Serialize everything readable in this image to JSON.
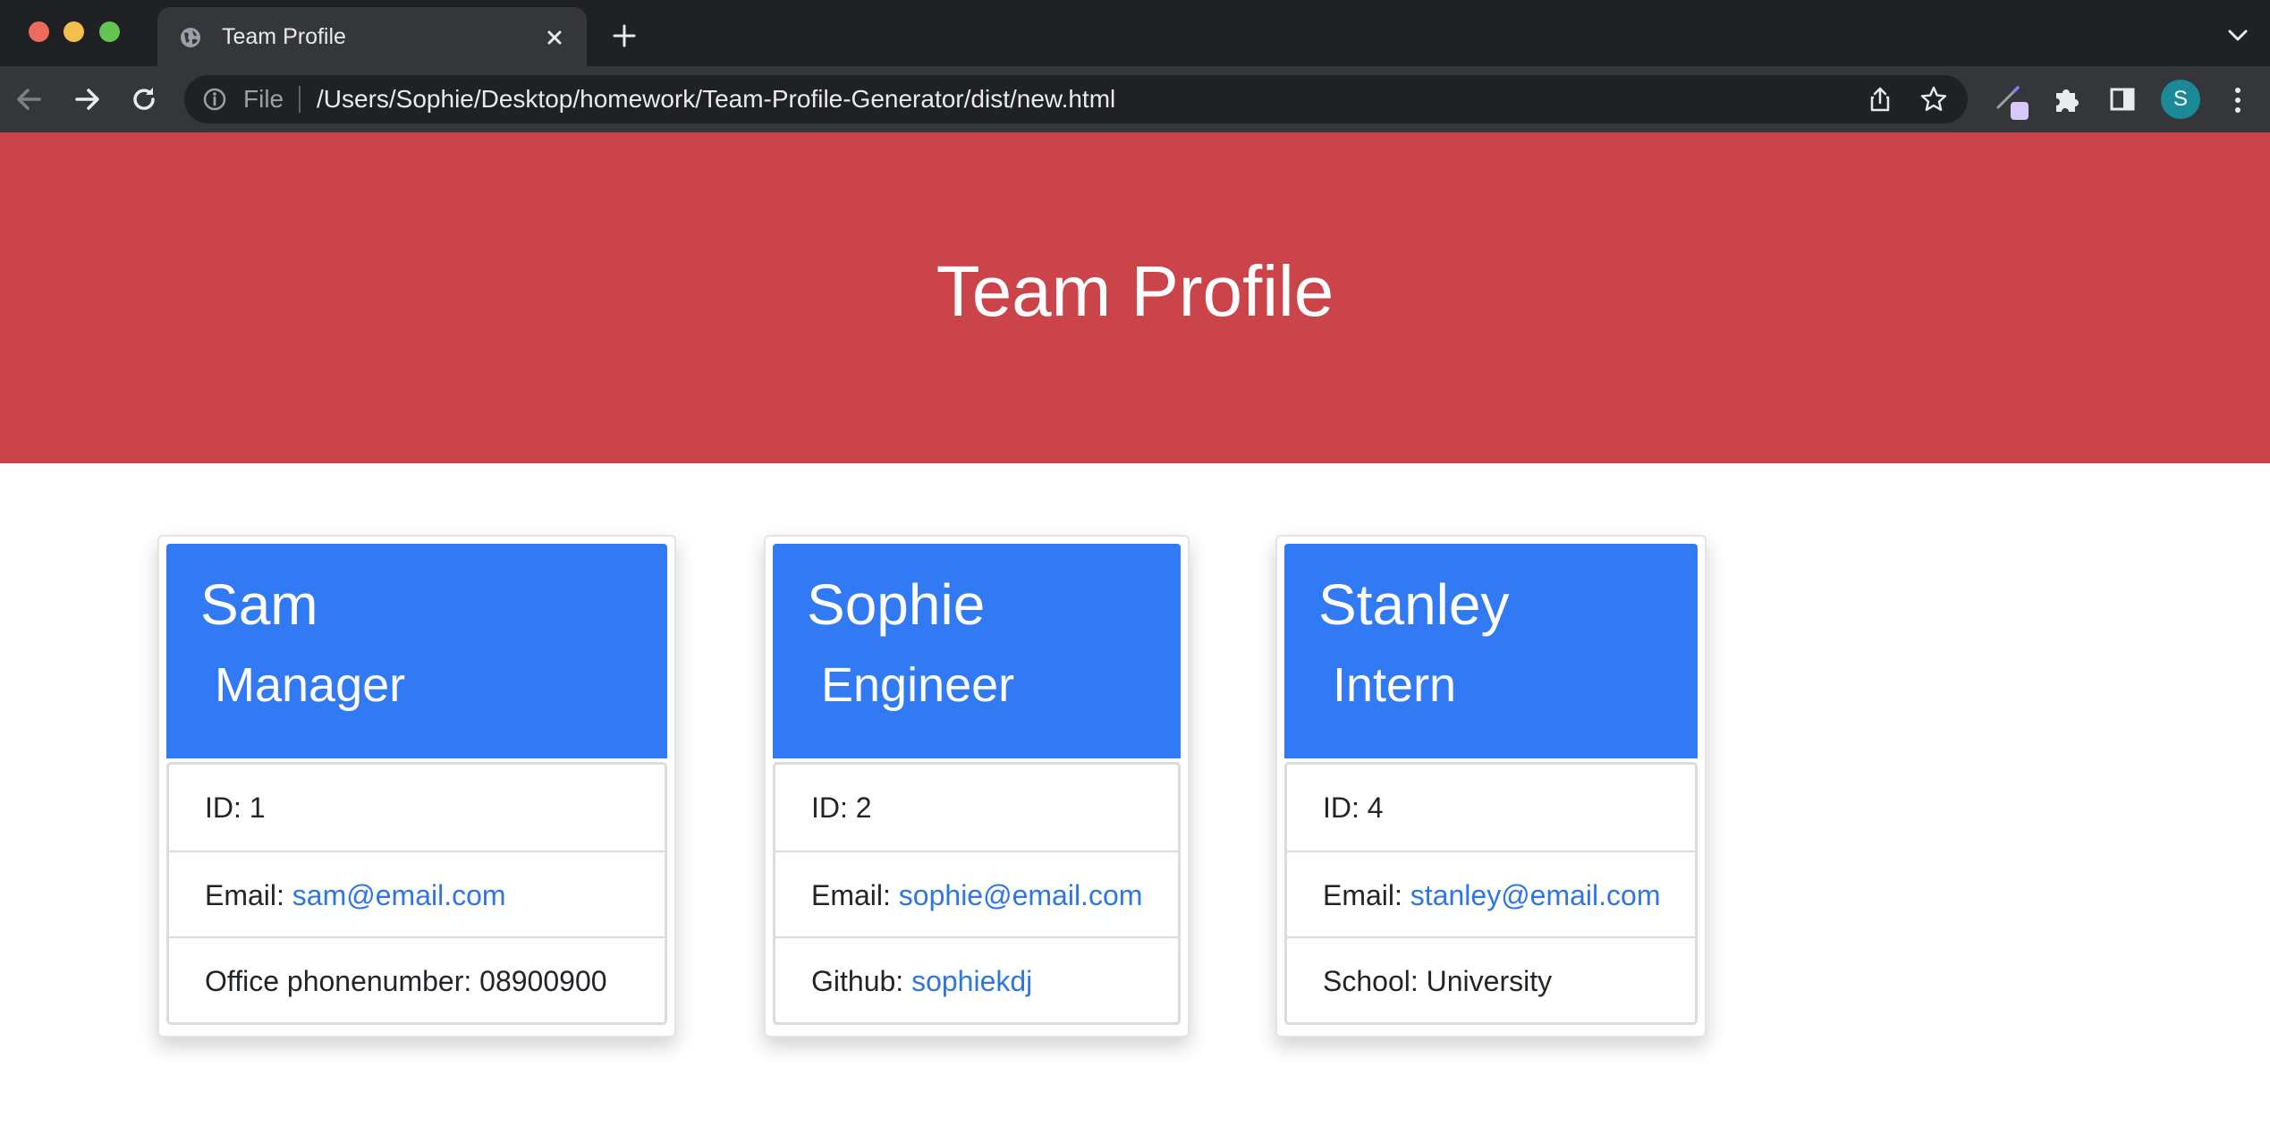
{
  "browser": {
    "tab_title": "Team Profile",
    "scheme_label": "File",
    "url": "/Users/Sophie/Desktop/homework/Team-Profile-Generator/dist/new.html",
    "profile_initial": "S"
  },
  "page": {
    "title": "Team Profile",
    "banner_color": "#cb444a",
    "card_header_color": "#3279f4",
    "link_color": "#2e75e6"
  },
  "team": [
    {
      "name": "Sam",
      "role": "Manager",
      "id_label": "ID: 1",
      "email_label": "Email: ",
      "email": "sam@email.com",
      "extra_label": "Office phonenumber: 08900900",
      "extra_value": ""
    },
    {
      "name": "Sophie",
      "role": "Engineer",
      "id_label": "ID: 2",
      "email_label": "Email: ",
      "email": "sophie@email.com",
      "extra_label": "Github: ",
      "extra_value": "sophiekdj"
    },
    {
      "name": "Stanley",
      "role": "Intern",
      "id_label": "ID: 4",
      "email_label": "Email: ",
      "email": "stanley@email.com",
      "extra_label": "School: University",
      "extra_value": ""
    }
  ]
}
